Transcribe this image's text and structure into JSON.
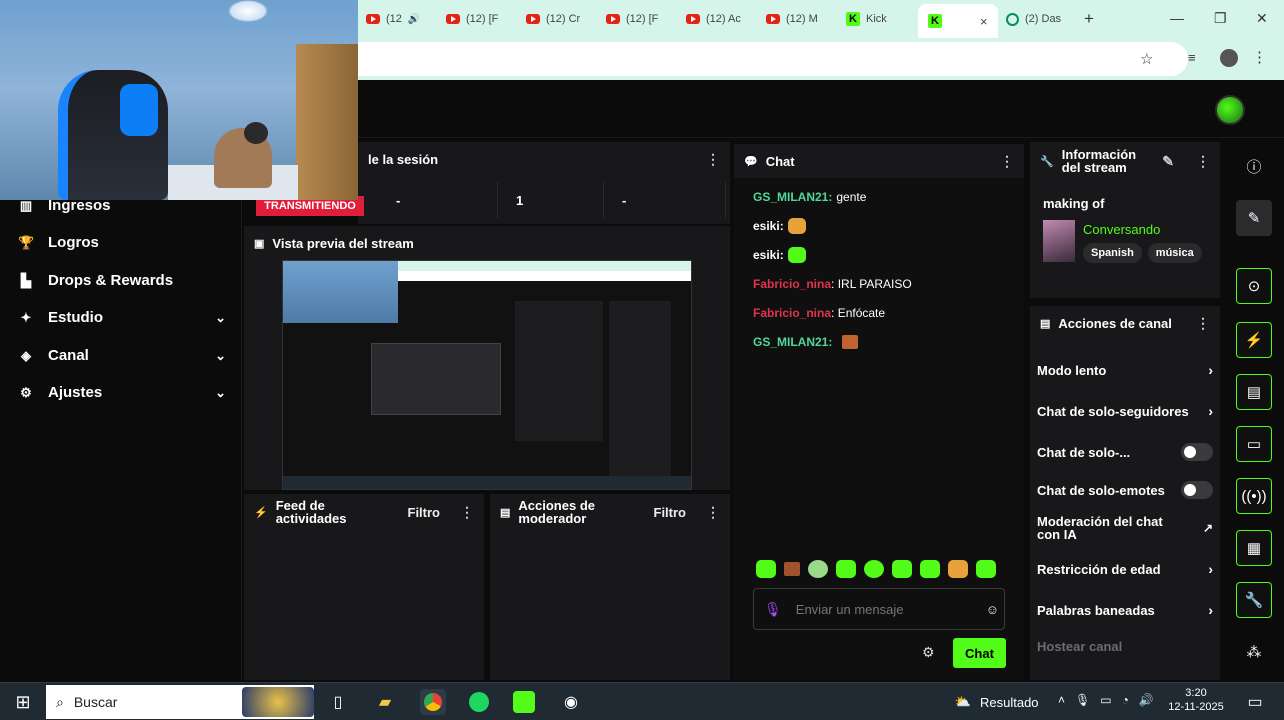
{
  "browser": {
    "tabs": [
      {
        "label": "(12",
        "icon": "youtube"
      },
      {
        "label": "(12) [F",
        "icon": "youtube"
      },
      {
        "label": "(12) Cr",
        "icon": "youtube"
      },
      {
        "label": "(12) [F",
        "icon": "youtube"
      },
      {
        "label": "(12) Ac",
        "icon": "youtube"
      },
      {
        "label": "(12) M",
        "icon": "youtube"
      },
      {
        "label": "Kick",
        "icon": "kick"
      },
      {
        "label": "",
        "icon": "kick",
        "active": true
      },
      {
        "label": "(2) Das",
        "icon": "ai"
      }
    ],
    "new_tab": "+",
    "close_tab": "×"
  },
  "sidebar": {
    "items": [
      {
        "label": "Ingresos",
        "icon": "income-icon",
        "chevron": false
      },
      {
        "label": "Logros",
        "icon": "trophy-icon",
        "chevron": false
      },
      {
        "label": "Drops & Rewards",
        "icon": "chart-icon",
        "chevron": false
      },
      {
        "label": "Estudio",
        "icon": "wand-icon",
        "chevron": true
      },
      {
        "label": "Canal",
        "icon": "channel-icon",
        "chevron": true
      },
      {
        "label": "Ajustes",
        "icon": "gear-icon",
        "chevron": true
      }
    ]
  },
  "session": {
    "title": "le la sesión",
    "badge": "TRANSMITIENDO",
    "stats": [
      "-",
      "1",
      "-"
    ]
  },
  "preview": {
    "title": "Vista previa del stream"
  },
  "feed": {
    "title_line1": "Feed de",
    "title_line2": "actividades",
    "filter": "Filtro"
  },
  "mod_actions": {
    "title_line1": "Acciones de",
    "title_line2": "moderador",
    "filter": "Filtro"
  },
  "chat": {
    "title": "Chat",
    "messages": [
      {
        "user": "GS_MILAN21:",
        "text": "gente",
        "color": "#53d69b"
      },
      {
        "user": "esiki:",
        "text": "",
        "emote": "#e8a23a",
        "color": "#ffffff"
      },
      {
        "user": "esiki:",
        "text": "",
        "emote": "#53fc18",
        "color": "#ffffff"
      },
      {
        "user": "Fabricio_nina",
        "text": ": IRL PARAISO",
        "color": "#e0334f"
      },
      {
        "user": "Fabricio_nina",
        "text": ": Enfócate",
        "color": "#e0334f"
      },
      {
        "user": "GS_MILAN21:",
        "text": "",
        "emote": "#c0642f",
        "color": "#53d69b"
      }
    ],
    "emotes": [
      "#53fc18",
      "#a0522d",
      "#9ad88a",
      "#53fc18",
      "#53fc18",
      "#53fc18",
      "#53fc18",
      "#e8a23a",
      "#53fc18"
    ],
    "placeholder": "Enviar un mensaje",
    "send_label": "Chat"
  },
  "stream_info": {
    "title_line1": "Información",
    "title_line2": "del stream",
    "stream_title": "making of",
    "category": "Conversando",
    "tags": [
      "Spanish",
      "música"
    ]
  },
  "channel_actions": {
    "title": "Acciones de canal",
    "rows": [
      {
        "label": "Modo lento",
        "control": "chevron"
      },
      {
        "label": "Chat de solo-seguidores",
        "control": "chevron"
      },
      {
        "label": "Chat de solo-...",
        "control": "toggle"
      },
      {
        "label": "Chat de solo-emotes",
        "control": "toggle"
      },
      {
        "label_line1": "Moderación del chat",
        "label_line2": "con IA",
        "control": "external"
      },
      {
        "label": "Restricción de edad",
        "control": "chevron"
      },
      {
        "label": "Palabras baneadas",
        "control": "chevron"
      },
      {
        "label": "Hostear canal",
        "control": "none",
        "muted": true
      }
    ]
  },
  "taskbar": {
    "search_placeholder": "Buscar",
    "weather": "Resultado",
    "time": "3:20",
    "date": "12-11-2025"
  },
  "colors": {
    "accent": "#53fc18",
    "live": "#e01e3c",
    "panel": "#18181b"
  }
}
